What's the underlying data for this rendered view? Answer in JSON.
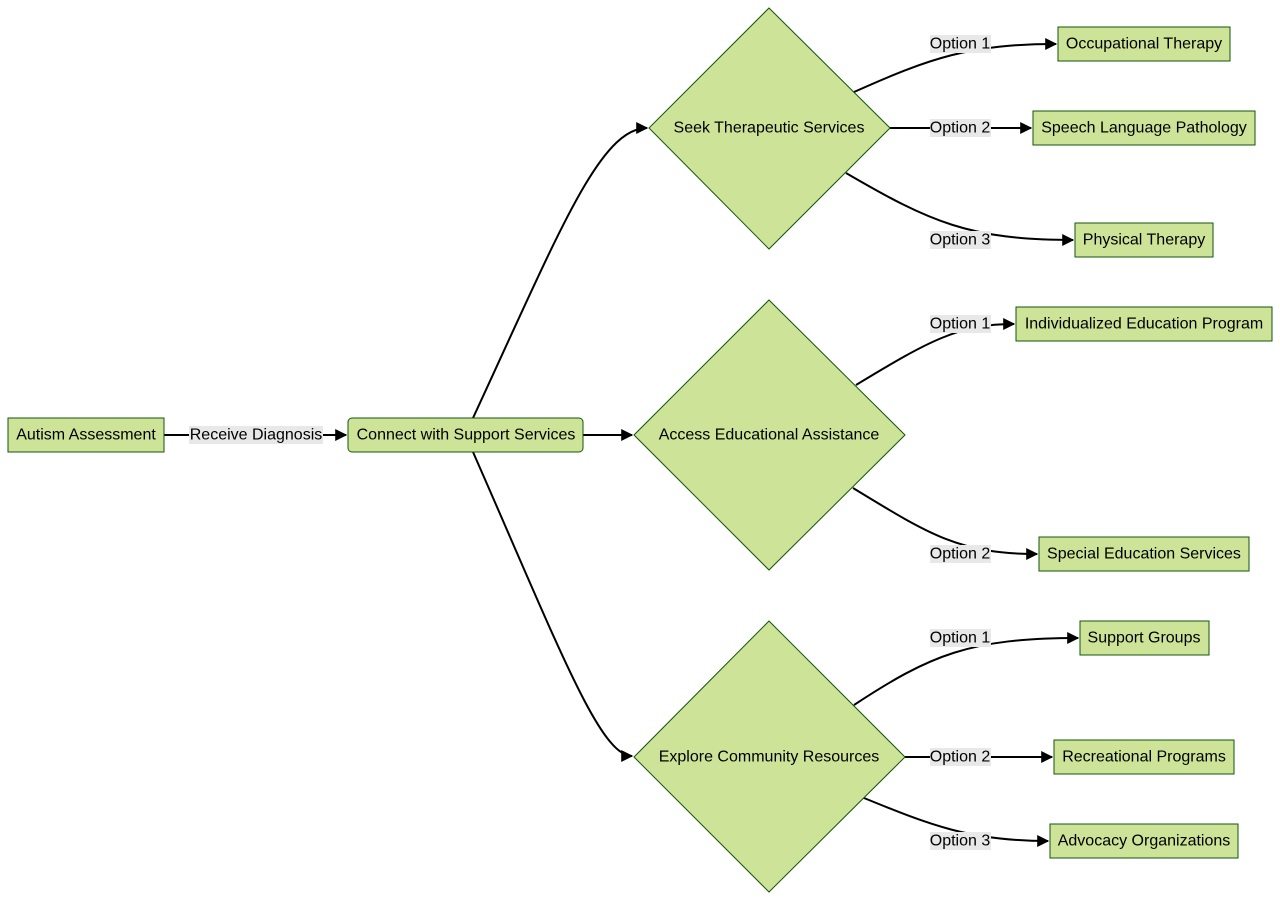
{
  "colors": {
    "node_fill": "#cde498",
    "node_stroke": "#13540c",
    "edge_label_bg": "#e8e8e8"
  },
  "nodes": {
    "assessment": "Autism Assessment",
    "connect": "Connect with Support Services",
    "therapeutic": "Seek Therapeutic Services",
    "educational": "Access Educational Assistance",
    "community": "Explore Community Resources",
    "ot": "Occupational Therapy",
    "slp": "Speech Language Pathology",
    "pt": "Physical Therapy",
    "iep": "Individualized Education Program",
    "ses": "Special Education Services",
    "sg": "Support Groups",
    "rp": "Recreational Programs",
    "ao": "Advocacy Organizations"
  },
  "edges": {
    "diagnosis": "Receive Diagnosis",
    "t1": "Option 1",
    "t2": "Option 2",
    "t3": "Option 3",
    "e1": "Option 1",
    "e2": "Option 2",
    "c1": "Option 1",
    "c2": "Option 2",
    "c3": "Option 3"
  }
}
